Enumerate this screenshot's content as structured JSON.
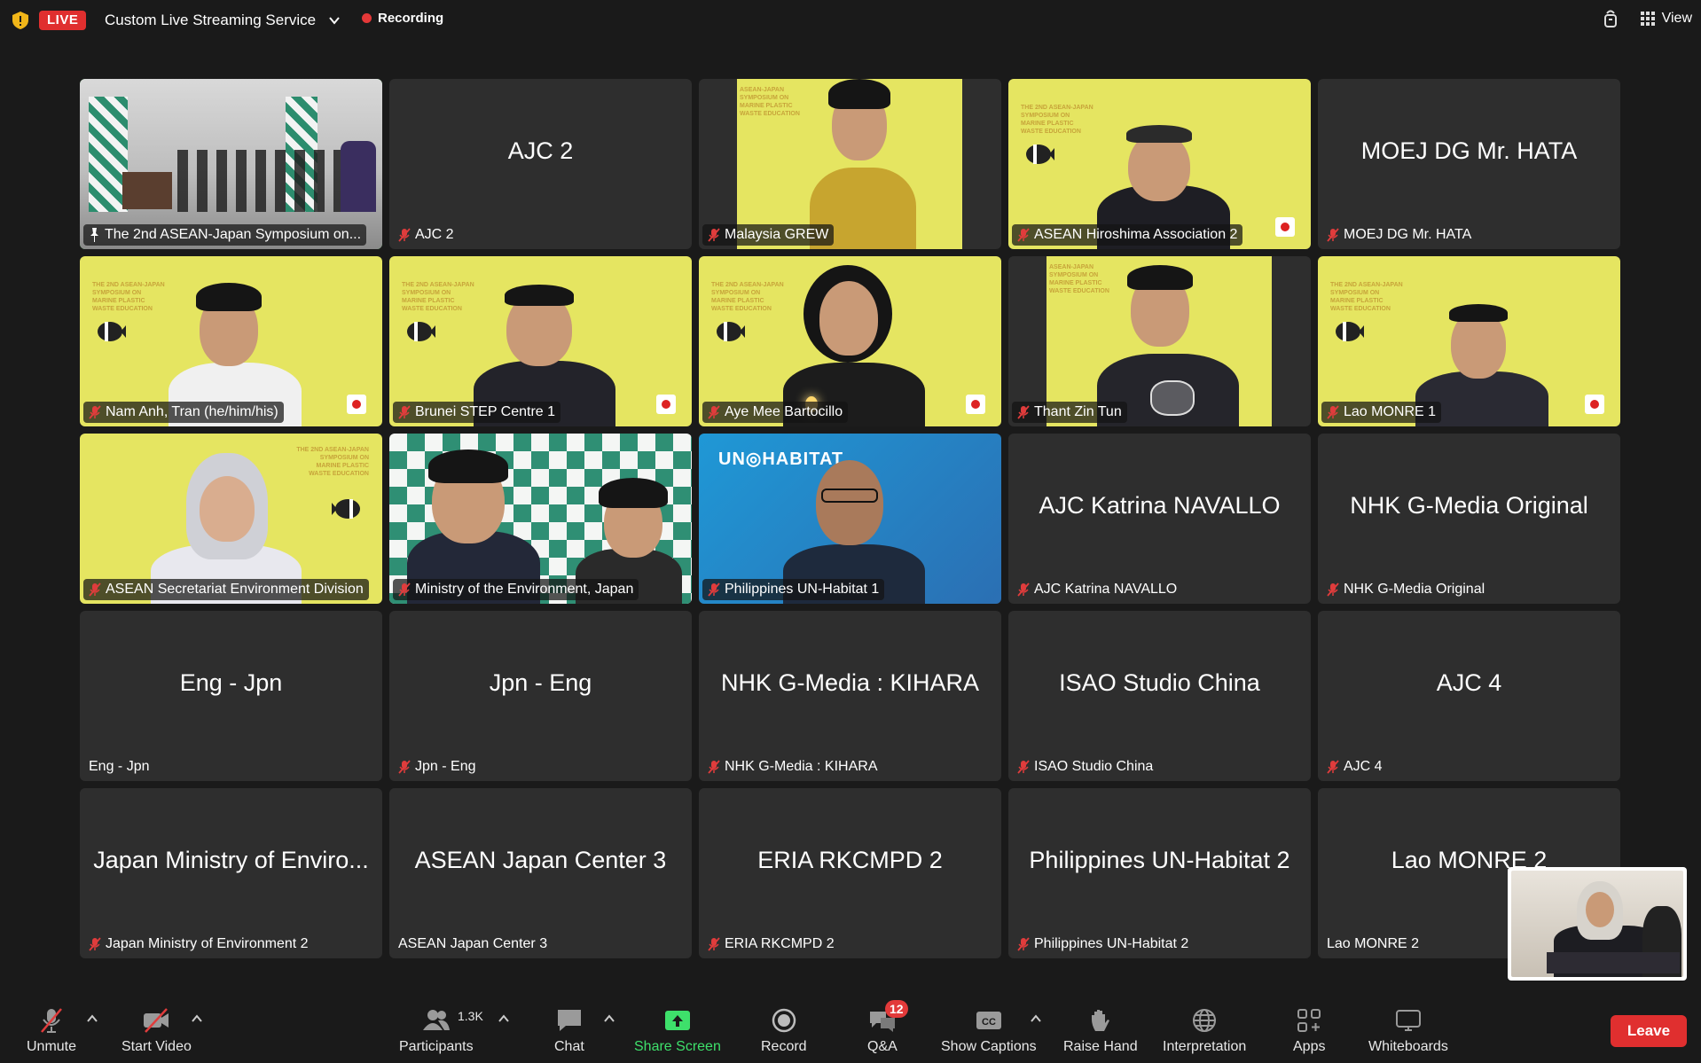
{
  "topbar": {
    "live_label": "LIVE",
    "stream_service": "Custom Live Streaming Service",
    "recording_label": "Recording",
    "view_label": "View"
  },
  "tiles": [
    {
      "big": "",
      "label": "The 2nd ASEAN-Japan Symposium on...",
      "icon": "pin-icon"
    },
    {
      "big": "AJC 2",
      "label": "AJC 2",
      "icon": "mute-icon"
    },
    {
      "big": "",
      "label": "Malaysia GREW",
      "icon": "mute-icon"
    },
    {
      "big": "",
      "label": "ASEAN Hiroshima Association 2",
      "icon": "mute-icon"
    },
    {
      "big": "MOEJ DG Mr. HATA",
      "label": "MOEJ DG Mr. HATA",
      "icon": "mute-icon"
    },
    {
      "big": "",
      "label": "Nam Anh, Tran (he/him/his)",
      "icon": "mute-icon"
    },
    {
      "big": "",
      "label": "Brunei STEP Centre 1",
      "icon": "mute-icon"
    },
    {
      "big": "",
      "label": "Aye Mee Bartocillo",
      "icon": "mute-icon"
    },
    {
      "big": "",
      "label": "Thant Zin Tun",
      "icon": "mute-icon"
    },
    {
      "big": "",
      "label": "Lao MONRE 1",
      "icon": "mute-icon"
    },
    {
      "big": "",
      "label": "ASEAN Secretariat Environment Division",
      "icon": "mute-icon"
    },
    {
      "big": "",
      "label": "Ministry of the Environment, Japan",
      "icon": "mute-icon"
    },
    {
      "big": "",
      "label": "Philippines UN-Habitat 1",
      "icon": "mute-icon"
    },
    {
      "big": "AJC Katrina NAVALLO",
      "label": "AJC Katrina NAVALLO",
      "icon": "mute-icon"
    },
    {
      "big": "NHK G-Media Original",
      "label": "NHK G-Media Original",
      "icon": "mute-icon"
    },
    {
      "big": "Eng - Jpn",
      "label": "Eng - Jpn",
      "icon": ""
    },
    {
      "big": "Jpn - Eng",
      "label": "Jpn - Eng",
      "icon": "mute-icon"
    },
    {
      "big": "NHK G-Media : KIHARA",
      "label": "NHK G-Media : KIHARA",
      "icon": "mute-icon"
    },
    {
      "big": "ISAO Studio China",
      "label": "ISAO Studio China",
      "icon": "mute-icon"
    },
    {
      "big": "AJC 4",
      "label": "AJC 4",
      "icon": "mute-icon"
    },
    {
      "big": "Japan Ministry of Enviro...",
      "label": "Japan Ministry of Environment 2",
      "icon": "mute-icon"
    },
    {
      "big": "ASEAN Japan Center 3",
      "label": "ASEAN Japan Center 3",
      "icon": ""
    },
    {
      "big": "ERIA RKCMPD 2",
      "label": "ERIA RKCMPD 2",
      "icon": "mute-icon"
    },
    {
      "big": "Philippines UN-Habitat 2",
      "label": "Philippines UN-Habitat 2",
      "icon": "mute-icon"
    },
    {
      "big": "Lao MONRE 2",
      "label": "Lao MONRE 2",
      "icon": ""
    }
  ],
  "toolbar": {
    "unmute": "Unmute",
    "start_video": "Start Video",
    "participants": "Participants",
    "participants_count": "1.3K",
    "chat": "Chat",
    "share_screen": "Share Screen",
    "record": "Record",
    "qa": "Q&A",
    "qa_badge": "12",
    "show_captions": "Show Captions",
    "raise_hand": "Raise Hand",
    "interpretation": "Interpretation",
    "apps": "Apps",
    "whiteboards": "Whiteboards",
    "leave": "Leave"
  },
  "colors": {
    "live": "#e02f2f",
    "active_speaker": "#3ccf4e",
    "share_green": "#3ee06b",
    "tile_bg": "#2e2e2e",
    "poster_yellow": "#e5e561"
  }
}
